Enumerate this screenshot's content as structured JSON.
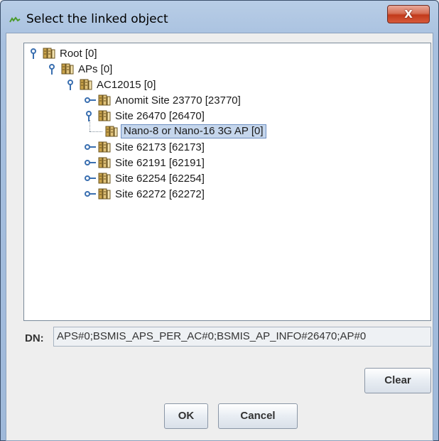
{
  "window": {
    "title": "Select the linked object",
    "close_label": "X",
    "app_icon": "linked-object-icon"
  },
  "tree": {
    "nodes": [
      {
        "label": "Root [0]",
        "depth": 0,
        "expanded": true,
        "selected": false
      },
      {
        "label": "APs [0]",
        "depth": 1,
        "expanded": true,
        "selected": false
      },
      {
        "label": "AC12015 [0]",
        "depth": 2,
        "expanded": true,
        "selected": false
      },
      {
        "label": "Anomit Site 23770 [23770]",
        "depth": 3,
        "expanded": false,
        "selected": false
      },
      {
        "label": "Site 26470 [26470]",
        "depth": 3,
        "expanded": true,
        "selected": false
      },
      {
        "label": "Nano-8 or Nano-16 3G AP [0]",
        "depth": 4,
        "leaf": true,
        "selected": true
      },
      {
        "label": "Site 62173 [62173]",
        "depth": 3,
        "expanded": false,
        "selected": false
      },
      {
        "label": "Site 62191 [62191]",
        "depth": 3,
        "expanded": false,
        "selected": false
      },
      {
        "label": "Site 62254 [62254]",
        "depth": 3,
        "expanded": false,
        "selected": false
      },
      {
        "label": "Site 62272 [62272]",
        "depth": 3,
        "expanded": false,
        "selected": false
      }
    ]
  },
  "dn": {
    "label": "DN:",
    "value": "APS#0;BSMIS_APS_PER_AC#0;BSMIS_AP_INFO#26470;AP#0"
  },
  "buttons": {
    "clear": "Clear",
    "ok": "OK",
    "cancel": "Cancel"
  }
}
